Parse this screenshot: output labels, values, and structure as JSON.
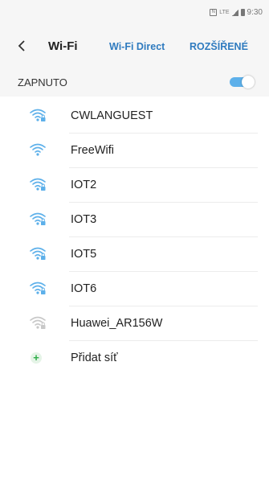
{
  "status_bar": {
    "time": "9:30",
    "icons": [
      "nfc-icon",
      "lte-icon",
      "signal-icon",
      "battery-icon"
    ]
  },
  "toolbar": {
    "back_icon": "chevron-left-icon",
    "title": "Wi-Fi",
    "wifi_direct_label": "Wi-Fi Direct",
    "advanced_label": "ROZŠÍŘENÉ"
  },
  "master_switch": {
    "label": "ZAPNUTO",
    "on": true
  },
  "colors": {
    "accent": "#2f7bbf",
    "wifi_icon": "#5db0ea",
    "wifi_icon_weak": "#c8c8c8",
    "toggle_on": "#5db0ea",
    "add_icon": "#2fae49",
    "header_bg": "#f6f6f6"
  },
  "networks": [
    {
      "name": "CWLANGUEST",
      "secured": true,
      "signal": "strong"
    },
    {
      "name": "FreeWifi",
      "secured": false,
      "signal": "strong"
    },
    {
      "name": "IOT2",
      "secured": true,
      "signal": "strong"
    },
    {
      "name": "IOT3",
      "secured": true,
      "signal": "strong"
    },
    {
      "name": "IOT5",
      "secured": true,
      "signal": "strong"
    },
    {
      "name": "IOT6",
      "secured": true,
      "signal": "strong"
    },
    {
      "name": "Huawei_AR156W",
      "secured": true,
      "signal": "weak"
    }
  ],
  "add_network": {
    "icon": "plus-icon",
    "label": "Přidat síť"
  }
}
